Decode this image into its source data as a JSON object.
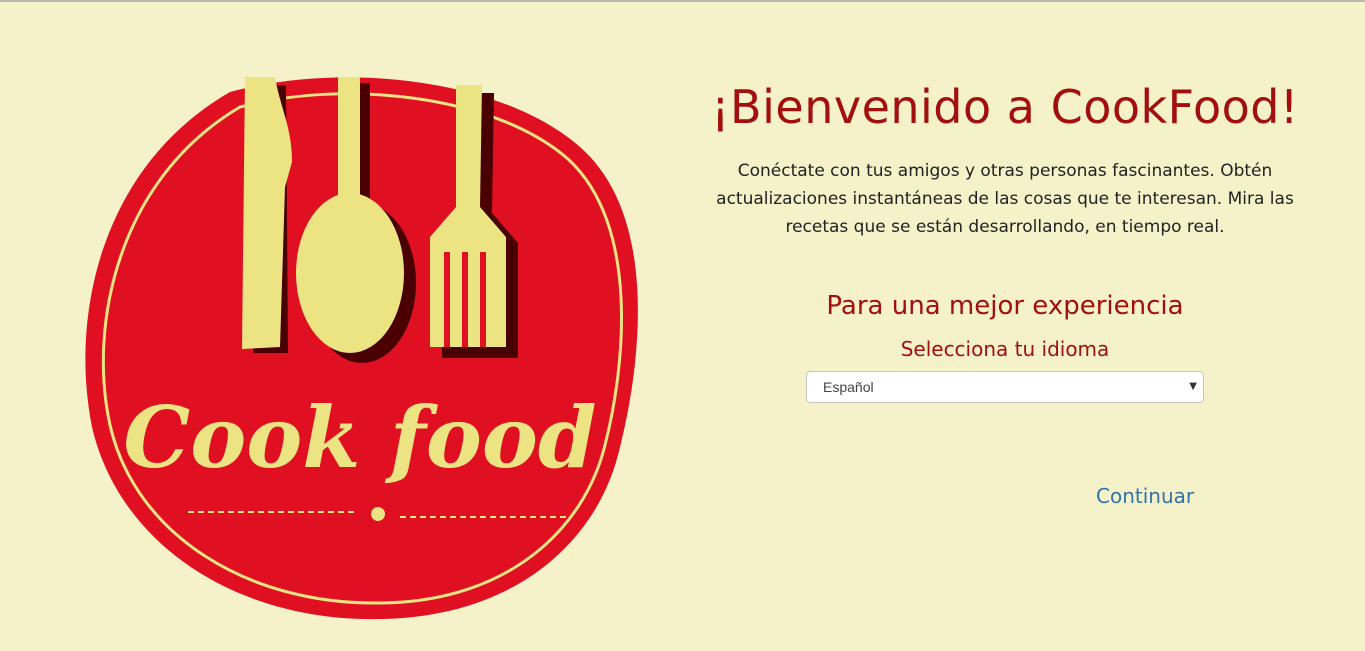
{
  "welcome": {
    "title": "¡Bienvenido a CookFood!",
    "description": "Conéctate con tus amigos y otras personas fascinantes. Obtén actualizaciones instantáneas de las cosas que te interesan. Mira las recetas que se están desarrollando, en tiempo real."
  },
  "language": {
    "heading": "Para una mejor experiencia",
    "label": "Selecciona tu idioma",
    "selected": "Español"
  },
  "actions": {
    "continue_label": "Continuar"
  },
  "logo": {
    "text": "Cook food"
  },
  "colors": {
    "background": "#f5f2c9",
    "brand_red": "#e00f22",
    "cream": "#ece383",
    "title_red": "#a30f0f",
    "link_blue": "#3172a8"
  }
}
